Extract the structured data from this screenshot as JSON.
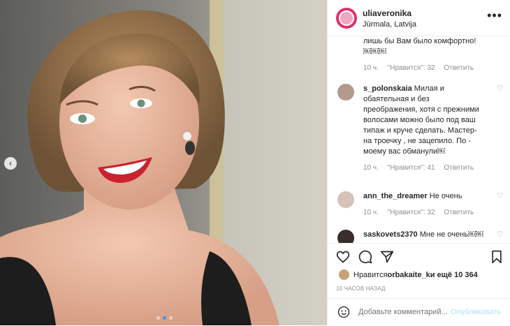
{
  "post": {
    "username": "uliaveronika",
    "location": "Jūrmala, Latvija",
    "more_icon": "more-dots-icon",
    "photo_alt": ""
  },
  "comments": [
    {
      "user": "",
      "text": "лишь бы Вам было комфортно! ￼￼￼",
      "time": "10 ч.",
      "likes": "\"Нравится\": 32",
      "reply": "Ответить"
    },
    {
      "user": "s_polonskaia",
      "text": "Милая и обаятельная и без преображения, хотя с прежними волосами можно было под ваш типаж и круче сделать. Мастер- на троечку , не зацепило. По - моему вас обманули￼",
      "time": "10 ч.",
      "likes": "\"Нравится\": 41",
      "reply": "Ответить"
    },
    {
      "user": "ann_the_dreamer",
      "text": "Не очень",
      "time": "10 ч.",
      "likes": "\"Нравится\": 32",
      "reply": "Ответить"
    },
    {
      "user": "saskovets2370",
      "text": "Мне не очень￼￼",
      "time": "",
      "likes": "",
      "reply": ""
    }
  ],
  "likes_line": {
    "prefix": "Нравится ",
    "user": "orbakaite_k",
    "suffix": " и ещё 10 364"
  },
  "timestamp": "10 ЧАСОВ НАЗАД",
  "add_comment": {
    "placeholder": "Добавьте комментарий...",
    "publish": "Опубликовать"
  },
  "colors": {
    "accent": "#3897f0",
    "publish_disabled": "#b2dffc",
    "muted": "#8e8e8e"
  }
}
